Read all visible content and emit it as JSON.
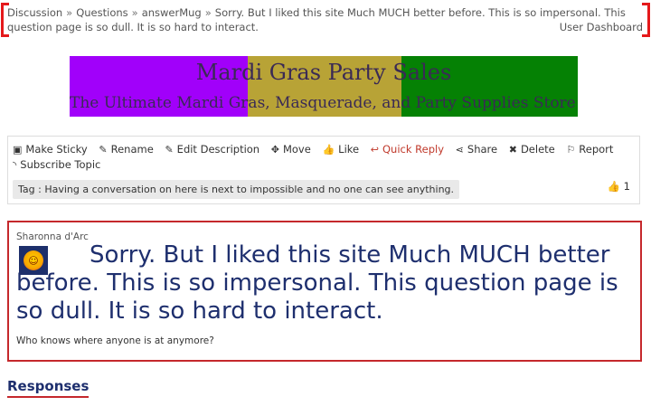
{
  "breadcrumb": {
    "items": [
      "Discussion",
      "Questions",
      "answerMug"
    ],
    "separator": "»",
    "current": "Sorry. But I liked this site Much MUCH better before. This is so impersonal. This question page is so dull. It is so hard to interact.",
    "user_dashboard": "User Dashboard"
  },
  "banner": {
    "title": "Mardi Gras Party Sales",
    "subtitle": "The Ultimate Mardi Gras, Masquerade, and Party Supplies Store!",
    "colors": [
      "#a100fa",
      "#b8a336",
      "#058104"
    ]
  },
  "actions": [
    {
      "label": "Make Sticky",
      "icon": "pin-icon"
    },
    {
      "label": "Rename",
      "icon": "pencil-icon"
    },
    {
      "label": "Edit Description",
      "icon": "pencil-icon"
    },
    {
      "label": "Move",
      "icon": "move-arrows-icon"
    },
    {
      "label": "Like",
      "icon": "thumbs-up-icon"
    },
    {
      "label": "Quick Reply",
      "icon": "reply-icon"
    },
    {
      "label": "Share",
      "icon": "share-icon"
    },
    {
      "label": "Delete",
      "icon": "x-icon"
    },
    {
      "label": "Report",
      "icon": "flag-icon"
    },
    {
      "label": "Subscribe Topic",
      "icon": "rss-icon"
    }
  ],
  "tag": "Tag : Having a conversation on here is next to impossible and no one can see anything.",
  "likes": "1",
  "question": {
    "author": "Sharonna d'Arc",
    "title": "Sorry. But I liked this site Much MUCH better before. This is so impersonal. This question page is so dull. It is so hard to interact.",
    "body": "Who knows where anyone is at anymore?"
  },
  "responses_heading": "Responses",
  "colors": {
    "accent": "#c5282c",
    "title": "#1e2f6e",
    "reply": "#c0392b"
  }
}
